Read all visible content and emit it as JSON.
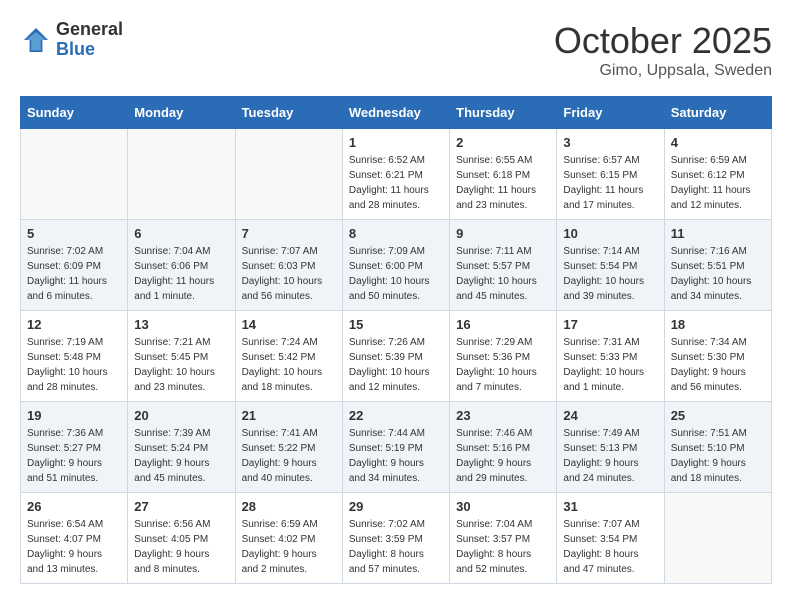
{
  "header": {
    "logo_general": "General",
    "logo_blue": "Blue",
    "title": "October 2025",
    "subtitle": "Gimo, Uppsala, Sweden"
  },
  "days_of_week": [
    "Sunday",
    "Monday",
    "Tuesday",
    "Wednesday",
    "Thursday",
    "Friday",
    "Saturday"
  ],
  "weeks": [
    [
      {
        "day": "",
        "info": ""
      },
      {
        "day": "",
        "info": ""
      },
      {
        "day": "",
        "info": ""
      },
      {
        "day": "1",
        "info": "Sunrise: 6:52 AM\nSunset: 6:21 PM\nDaylight: 11 hours\nand 28 minutes."
      },
      {
        "day": "2",
        "info": "Sunrise: 6:55 AM\nSunset: 6:18 PM\nDaylight: 11 hours\nand 23 minutes."
      },
      {
        "day": "3",
        "info": "Sunrise: 6:57 AM\nSunset: 6:15 PM\nDaylight: 11 hours\nand 17 minutes."
      },
      {
        "day": "4",
        "info": "Sunrise: 6:59 AM\nSunset: 6:12 PM\nDaylight: 11 hours\nand 12 minutes."
      }
    ],
    [
      {
        "day": "5",
        "info": "Sunrise: 7:02 AM\nSunset: 6:09 PM\nDaylight: 11 hours\nand 6 minutes."
      },
      {
        "day": "6",
        "info": "Sunrise: 7:04 AM\nSunset: 6:06 PM\nDaylight: 11 hours\nand 1 minute."
      },
      {
        "day": "7",
        "info": "Sunrise: 7:07 AM\nSunset: 6:03 PM\nDaylight: 10 hours\nand 56 minutes."
      },
      {
        "day": "8",
        "info": "Sunrise: 7:09 AM\nSunset: 6:00 PM\nDaylight: 10 hours\nand 50 minutes."
      },
      {
        "day": "9",
        "info": "Sunrise: 7:11 AM\nSunset: 5:57 PM\nDaylight: 10 hours\nand 45 minutes."
      },
      {
        "day": "10",
        "info": "Sunrise: 7:14 AM\nSunset: 5:54 PM\nDaylight: 10 hours\nand 39 minutes."
      },
      {
        "day": "11",
        "info": "Sunrise: 7:16 AM\nSunset: 5:51 PM\nDaylight: 10 hours\nand 34 minutes."
      }
    ],
    [
      {
        "day": "12",
        "info": "Sunrise: 7:19 AM\nSunset: 5:48 PM\nDaylight: 10 hours\nand 28 minutes."
      },
      {
        "day": "13",
        "info": "Sunrise: 7:21 AM\nSunset: 5:45 PM\nDaylight: 10 hours\nand 23 minutes."
      },
      {
        "day": "14",
        "info": "Sunrise: 7:24 AM\nSunset: 5:42 PM\nDaylight: 10 hours\nand 18 minutes."
      },
      {
        "day": "15",
        "info": "Sunrise: 7:26 AM\nSunset: 5:39 PM\nDaylight: 10 hours\nand 12 minutes."
      },
      {
        "day": "16",
        "info": "Sunrise: 7:29 AM\nSunset: 5:36 PM\nDaylight: 10 hours\nand 7 minutes."
      },
      {
        "day": "17",
        "info": "Sunrise: 7:31 AM\nSunset: 5:33 PM\nDaylight: 10 hours\nand 1 minute."
      },
      {
        "day": "18",
        "info": "Sunrise: 7:34 AM\nSunset: 5:30 PM\nDaylight: 9 hours\nand 56 minutes."
      }
    ],
    [
      {
        "day": "19",
        "info": "Sunrise: 7:36 AM\nSunset: 5:27 PM\nDaylight: 9 hours\nand 51 minutes."
      },
      {
        "day": "20",
        "info": "Sunrise: 7:39 AM\nSunset: 5:24 PM\nDaylight: 9 hours\nand 45 minutes."
      },
      {
        "day": "21",
        "info": "Sunrise: 7:41 AM\nSunset: 5:22 PM\nDaylight: 9 hours\nand 40 minutes."
      },
      {
        "day": "22",
        "info": "Sunrise: 7:44 AM\nSunset: 5:19 PM\nDaylight: 9 hours\nand 34 minutes."
      },
      {
        "day": "23",
        "info": "Sunrise: 7:46 AM\nSunset: 5:16 PM\nDaylight: 9 hours\nand 29 minutes."
      },
      {
        "day": "24",
        "info": "Sunrise: 7:49 AM\nSunset: 5:13 PM\nDaylight: 9 hours\nand 24 minutes."
      },
      {
        "day": "25",
        "info": "Sunrise: 7:51 AM\nSunset: 5:10 PM\nDaylight: 9 hours\nand 18 minutes."
      }
    ],
    [
      {
        "day": "26",
        "info": "Sunrise: 6:54 AM\nSunset: 4:07 PM\nDaylight: 9 hours\nand 13 minutes."
      },
      {
        "day": "27",
        "info": "Sunrise: 6:56 AM\nSunset: 4:05 PM\nDaylight: 9 hours\nand 8 minutes."
      },
      {
        "day": "28",
        "info": "Sunrise: 6:59 AM\nSunset: 4:02 PM\nDaylight: 9 hours\nand 2 minutes."
      },
      {
        "day": "29",
        "info": "Sunrise: 7:02 AM\nSunset: 3:59 PM\nDaylight: 8 hours\nand 57 minutes."
      },
      {
        "day": "30",
        "info": "Sunrise: 7:04 AM\nSunset: 3:57 PM\nDaylight: 8 hours\nand 52 minutes."
      },
      {
        "day": "31",
        "info": "Sunrise: 7:07 AM\nSunset: 3:54 PM\nDaylight: 8 hours\nand 47 minutes."
      },
      {
        "day": "",
        "info": ""
      }
    ]
  ]
}
